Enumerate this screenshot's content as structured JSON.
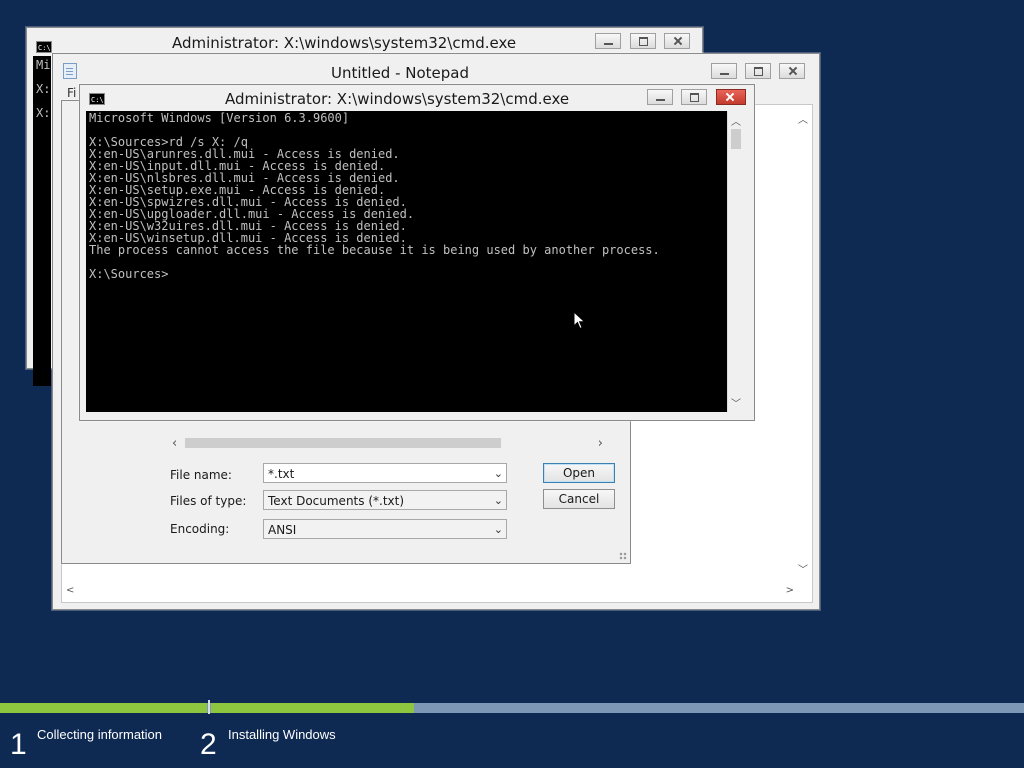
{
  "desktop": {
    "background_color": "#0e2a52"
  },
  "cmd_back": {
    "title": "Administrator: X:\\windows\\system32\\cmd.exe",
    "console_lines": [
      "Mi",
      "",
      "",
      "X:",
      "",
      "X:"
    ]
  },
  "notepad": {
    "title": "Untitled - Notepad",
    "menu_visible": "Fi"
  },
  "open_dialog": {
    "file_name_label": "File name:",
    "file_name_value": "*.txt",
    "files_of_type_label": "Files of type:",
    "files_of_type_value": "Text Documents (*.txt)",
    "encoding_label": "Encoding:",
    "encoding_value": "ANSI",
    "open_label": "Open",
    "cancel_label": "Cancel"
  },
  "cmd_main": {
    "title": "Administrator: X:\\windows\\system32\\cmd.exe",
    "console_lines": [
      "Microsoft Windows [Version 6.3.9600]",
      "",
      "X:\\Sources>rd /s X: /q",
      "X:en-US\\arunres.dll.mui - Access is denied.",
      "X:en-US\\input.dll.mui - Access is denied.",
      "X:en-US\\nlsbres.dll.mui - Access is denied.",
      "X:en-US\\setup.exe.mui - Access is denied.",
      "X:en-US\\spwizres.dll.mui - Access is denied.",
      "X:en-US\\upgloader.dll.mui - Access is denied.",
      "X:en-US\\w32uires.dll.mui - Access is denied.",
      "X:en-US\\winsetup.dll.mui - Access is denied.",
      "The process cannot access the file because it is being used by another process.",
      "",
      "X:\\Sources>"
    ]
  },
  "setup_progress": {
    "steps": [
      {
        "number": "1",
        "label": "Collecting information",
        "progress": 1.0
      },
      {
        "number": "2",
        "label": "Installing Windows",
        "progress": 0.25
      }
    ],
    "accent_color": "#8dc63f"
  }
}
